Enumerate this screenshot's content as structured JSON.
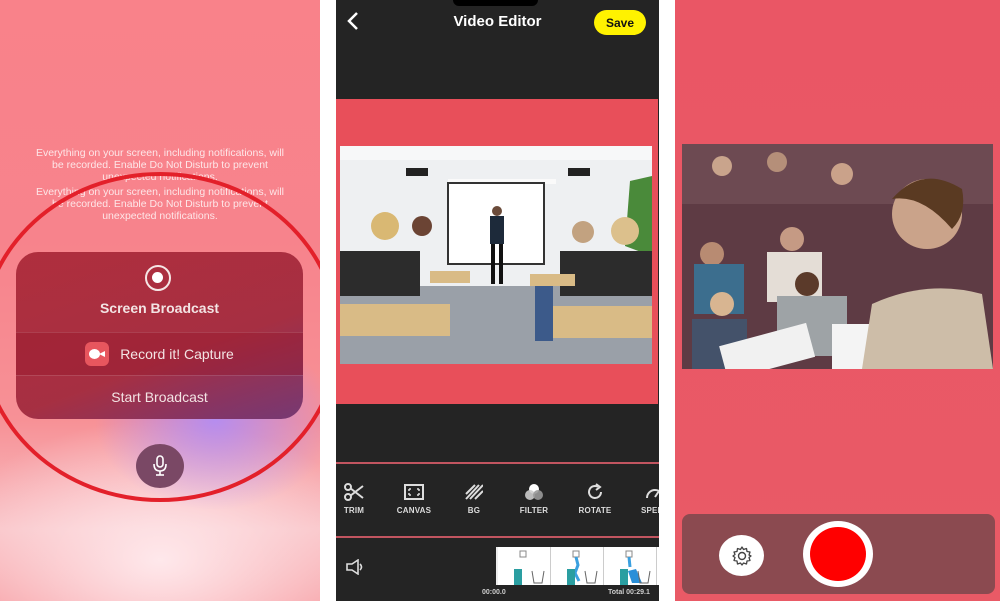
{
  "screens": {
    "broadcast": {
      "notice_text": "Everything on your screen, including notifications, will be recorded. Enable Do Not Disturb to prevent unexpected notifications.",
      "card_title": "Screen Broadcast",
      "app_option": "Record it! Capture",
      "start_label": "Start Broadcast",
      "icons": {
        "record": "record-circle-icon",
        "app": "record-it-app-icon",
        "mic": "microphone-icon"
      },
      "highlight_color": "#e3202a"
    },
    "editor": {
      "title": "Video Editor",
      "back_label": "<",
      "save_label": "Save",
      "accent_color": "#fff200",
      "canvas_color": "#e84f5a",
      "tools": [
        {
          "label": "TRIM",
          "icon": "scissors-icon"
        },
        {
          "label": "CANVAS",
          "icon": "canvas-icon"
        },
        {
          "label": "BG",
          "icon": "background-pattern-icon"
        },
        {
          "label": "FILTER",
          "icon": "filter-icon"
        },
        {
          "label": "ROTATE",
          "icon": "rotate-icon"
        },
        {
          "label": "SPEED",
          "icon": "speed-gauge-icon"
        }
      ],
      "timeline": {
        "start": "00:00.0",
        "total": "Total 00:29.1"
      }
    },
    "recorder": {
      "background_color": "#ea5665",
      "record_color": "#ff0000",
      "icons": {
        "settings": "gear-icon",
        "record": "record-button"
      }
    }
  }
}
